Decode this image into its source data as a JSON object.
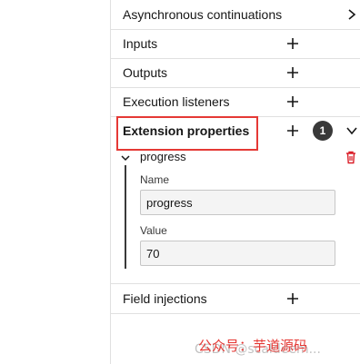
{
  "groups": [
    {
      "label": "Asynchronous continuations",
      "control": "chevron-right"
    },
    {
      "label": "Inputs",
      "control": "plus"
    },
    {
      "label": "Outputs",
      "control": "plus"
    },
    {
      "label": "Execution listeners",
      "control": "plus"
    },
    {
      "label": "Extension properties",
      "control": "plus",
      "badge": "1",
      "expanded": true
    },
    {
      "label": "Field injections",
      "control": "plus"
    }
  ],
  "extension_property": {
    "entry_label": "progress",
    "name_label": "Name",
    "name_value": "progress",
    "value_label": "Value",
    "value_value": "70"
  },
  "watermark": {
    "text": "公众号：芋道源码",
    "sub": "CSDN @scaldeem..."
  },
  "colors": {
    "highlight": "#e53935",
    "badge_bg": "#393939",
    "delete_icon": "#da1e28",
    "divider": "#e0e0e0"
  }
}
